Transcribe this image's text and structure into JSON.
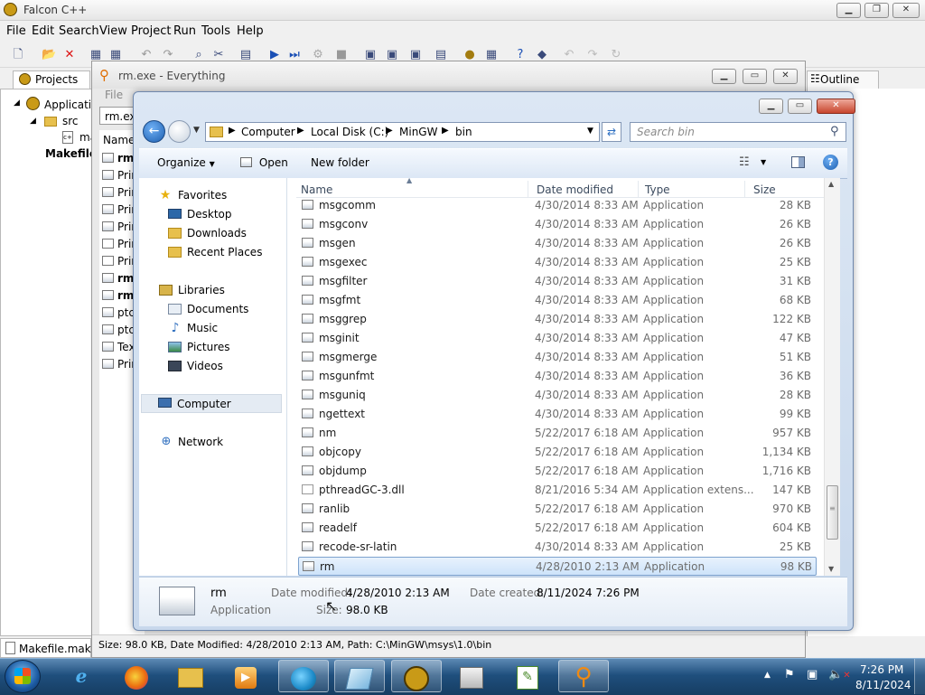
{
  "falcon": {
    "title": "Falcon C++",
    "menu": [
      "File",
      "Edit",
      "Search",
      "View",
      "Project",
      "Run",
      "Tools",
      "Help"
    ],
    "left_tab": "Projects",
    "right_tab": "Outline",
    "tree": {
      "root": "Application",
      "src": "src",
      "file": "ma",
      "makefile": "Makefile."
    },
    "bottom_tab": "Makefile.mak"
  },
  "everything": {
    "title": "rm.exe - Everything",
    "menu_file": "File",
    "search": "rm.exe",
    "col_name": "Name",
    "rows": [
      {
        "text": "rm.",
        "bold": true,
        "icon": "gray"
      },
      {
        "text": "Prin",
        "bold": false,
        "icon": "gray"
      },
      {
        "text": "Prin",
        "bold": false,
        "icon": "gray"
      },
      {
        "text": "Prin",
        "bold": false,
        "icon": "gray"
      },
      {
        "text": "Prin",
        "bold": false,
        "icon": "gray"
      },
      {
        "text": "Prin",
        "bold": false,
        "icon": "white"
      },
      {
        "text": "Prin",
        "bold": false,
        "icon": "white"
      },
      {
        "text": "rm.",
        "bold": true,
        "icon": "gray"
      },
      {
        "text": "rm.",
        "bold": true,
        "icon": "gray"
      },
      {
        "text": "ptc",
        "bold": false,
        "icon": "gray"
      },
      {
        "text": "ptc",
        "bold": false,
        "icon": "gray"
      },
      {
        "text": "Tex",
        "bold": false,
        "icon": "gray"
      },
      {
        "text": "Prin",
        "bold": false,
        "icon": "gray"
      }
    ],
    "status": "Size: 98.0 KB, Date Modified: 4/28/2010 2:13 AM, Path: C:\\MinGW\\msys\\1.0\\bin"
  },
  "dialog": {
    "breadcrumb": [
      "Computer",
      "Local Disk (C:)",
      "MinGW",
      "bin"
    ],
    "search_placeholder": "Search bin",
    "toolbar": {
      "organize": "Organize",
      "open": "Open",
      "new_folder": "New folder"
    },
    "nav": {
      "favorites": "Favorites",
      "desktop": "Desktop",
      "downloads": "Downloads",
      "recent": "Recent Places",
      "libraries": "Libraries",
      "documents": "Documents",
      "music": "Music",
      "pictures": "Pictures",
      "videos": "Videos",
      "computer": "Computer",
      "network": "Network"
    },
    "columns": {
      "name": "Name",
      "date": "Date modified",
      "type": "Type",
      "size": "Size"
    },
    "files": [
      {
        "name": "msgcomm",
        "date": "4/30/2014 8:33 AM",
        "type": "Application",
        "size": "28 KB"
      },
      {
        "name": "msgconv",
        "date": "4/30/2014 8:33 AM",
        "type": "Application",
        "size": "26 KB"
      },
      {
        "name": "msgen",
        "date": "4/30/2014 8:33 AM",
        "type": "Application",
        "size": "26 KB"
      },
      {
        "name": "msgexec",
        "date": "4/30/2014 8:33 AM",
        "type": "Application",
        "size": "25 KB"
      },
      {
        "name": "msgfilter",
        "date": "4/30/2014 8:33 AM",
        "type": "Application",
        "size": "31 KB"
      },
      {
        "name": "msgfmt",
        "date": "4/30/2014 8:33 AM",
        "type": "Application",
        "size": "68 KB"
      },
      {
        "name": "msggrep",
        "date": "4/30/2014 8:33 AM",
        "type": "Application",
        "size": "122 KB"
      },
      {
        "name": "msginit",
        "date": "4/30/2014 8:33 AM",
        "type": "Application",
        "size": "47 KB"
      },
      {
        "name": "msgmerge",
        "date": "4/30/2014 8:33 AM",
        "type": "Application",
        "size": "51 KB"
      },
      {
        "name": "msgunfmt",
        "date": "4/30/2014 8:33 AM",
        "type": "Application",
        "size": "36 KB"
      },
      {
        "name": "msguniq",
        "date": "4/30/2014 8:33 AM",
        "type": "Application",
        "size": "28 KB"
      },
      {
        "name": "ngettext",
        "date": "4/30/2014 8:33 AM",
        "type": "Application",
        "size": "99 KB"
      },
      {
        "name": "nm",
        "date": "5/22/2017 6:18 AM",
        "type": "Application",
        "size": "957 KB"
      },
      {
        "name": "objcopy",
        "date": "5/22/2017 6:18 AM",
        "type": "Application",
        "size": "1,134 KB"
      },
      {
        "name": "objdump",
        "date": "5/22/2017 6:18 AM",
        "type": "Application",
        "size": "1,716 KB"
      },
      {
        "name": "pthreadGC-3.dll",
        "date": "8/21/2016 5:34 AM",
        "type": "Application extens...",
        "size": "147 KB",
        "icon": "dll"
      },
      {
        "name": "ranlib",
        "date": "5/22/2017 6:18 AM",
        "type": "Application",
        "size": "970 KB"
      },
      {
        "name": "readelf",
        "date": "5/22/2017 6:18 AM",
        "type": "Application",
        "size": "604 KB"
      },
      {
        "name": "recode-sr-latin",
        "date": "4/30/2014 8:33 AM",
        "type": "Application",
        "size": "25 KB"
      },
      {
        "name": "rm",
        "date": "4/28/2010 2:13 AM",
        "type": "Application",
        "size": "98 KB",
        "selected": true
      }
    ],
    "details": {
      "name": "rm",
      "type": "Application",
      "date_modified_label": "Date modified:",
      "date_modified": "4/28/2010 2:13 AM",
      "date_created_label": "Date created:",
      "date_created": "8/11/2024 7:26 PM",
      "size_label": "Size:",
      "size": "98.0 KB"
    }
  },
  "taskbar": {
    "time": "7:26 PM",
    "date": "8/11/2024"
  },
  "colors": {
    "taskbar": "#1c4f7c",
    "selection": "#cde3fa",
    "title_text": "#4a4a4a"
  }
}
